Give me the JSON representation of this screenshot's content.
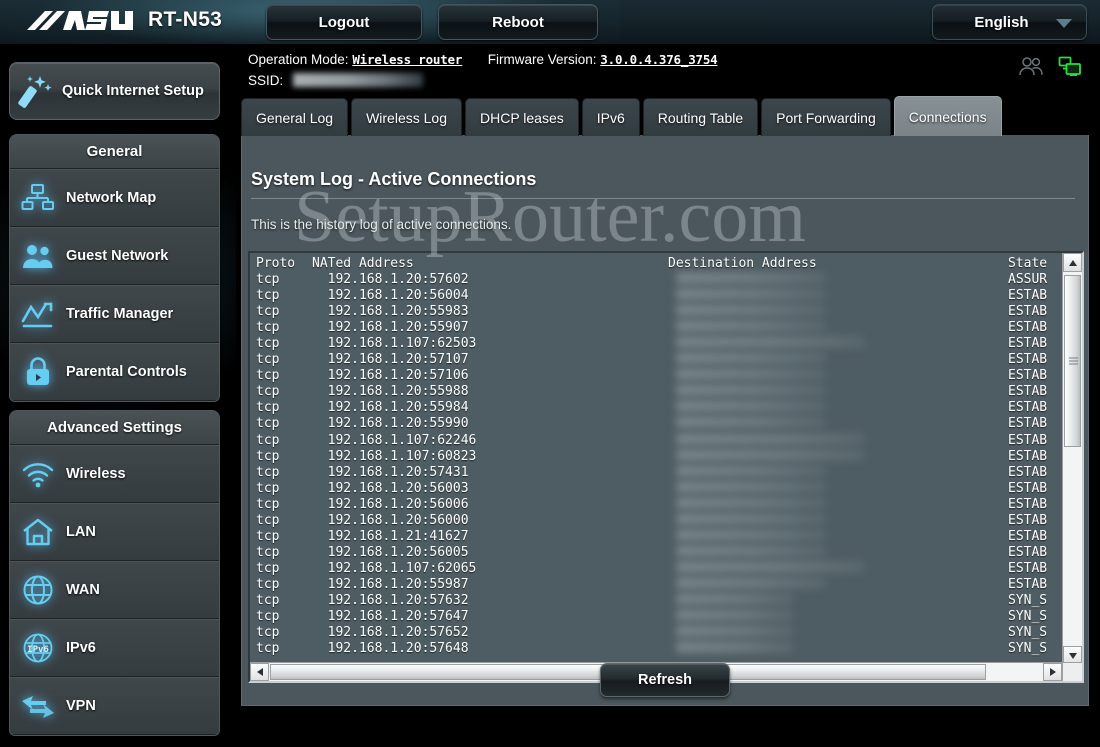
{
  "header": {
    "brand": "ASUS",
    "model": "RT-N53",
    "logout_label": "Logout",
    "reboot_label": "Reboot",
    "language": "English",
    "icons": {
      "clients": "users-icon",
      "network_status": "connected-computers-icon"
    }
  },
  "info": {
    "operation_mode_label": "Operation Mode:",
    "operation_mode_value": "Wireless router",
    "firmware_label": "Firmware Version:",
    "firmware_value": "3.0.0.4.376_3754",
    "ssid_label": "SSID:",
    "ssid_value": ""
  },
  "sidebar": {
    "quick_setup": "Quick Internet Setup",
    "groups": [
      {
        "title": "General",
        "items": [
          {
            "label": "Network Map",
            "icon": "network-map-icon"
          },
          {
            "label": "Guest Network",
            "icon": "guest-network-icon"
          },
          {
            "label": "Traffic Manager",
            "icon": "traffic-manager-icon"
          },
          {
            "label": "Parental Controls",
            "icon": "padlock-icon"
          }
        ]
      },
      {
        "title": "Advanced Settings",
        "items": [
          {
            "label": "Wireless",
            "icon": "wifi-icon"
          },
          {
            "label": "LAN",
            "icon": "home-icon"
          },
          {
            "label": "WAN",
            "icon": "globe-icon"
          },
          {
            "label": "IPv6",
            "icon": "ipv6-globe-icon"
          },
          {
            "label": "VPN",
            "icon": "vpn-arrows-icon"
          }
        ]
      }
    ]
  },
  "tabs": [
    {
      "label": "General Log",
      "active": false
    },
    {
      "label": "Wireless Log",
      "active": false
    },
    {
      "label": "DHCP leases",
      "active": false
    },
    {
      "label": "IPv6",
      "active": false
    },
    {
      "label": "Routing Table",
      "active": false
    },
    {
      "label": "Port Forwarding",
      "active": false
    },
    {
      "label": "Connections",
      "active": true
    }
  ],
  "panel": {
    "title": "System Log - Active Connections",
    "description": "This is the history log of active connections.",
    "refresh_label": "Refresh"
  },
  "log": {
    "columns": [
      "Proto",
      "NATed Address",
      "Destination Address",
      "State"
    ],
    "rows": [
      {
        "proto": "tcp",
        "nated": "192.168.1.20:57602",
        "dest": "",
        "state": "ASSUR"
      },
      {
        "proto": "tcp",
        "nated": "192.168.1.20:56004",
        "dest": "",
        "state": "ESTAB"
      },
      {
        "proto": "tcp",
        "nated": "192.168.1.20:55983",
        "dest": "",
        "state": "ESTAB"
      },
      {
        "proto": "tcp",
        "nated": "192.168.1.20:55907",
        "dest": "",
        "state": "ESTAB"
      },
      {
        "proto": "tcp",
        "nated": "192.168.1.107:62503",
        "dest": "",
        "state": "ESTAB"
      },
      {
        "proto": "tcp",
        "nated": "192.168.1.20:57107",
        "dest": "",
        "state": "ESTAB"
      },
      {
        "proto": "tcp",
        "nated": "192.168.1.20:57106",
        "dest": "",
        "state": "ESTAB"
      },
      {
        "proto": "tcp",
        "nated": "192.168.1.20:55988",
        "dest": "",
        "state": "ESTAB"
      },
      {
        "proto": "tcp",
        "nated": "192.168.1.20:55984",
        "dest": "",
        "state": "ESTAB"
      },
      {
        "proto": "tcp",
        "nated": "192.168.1.20:55990",
        "dest": "",
        "state": "ESTAB"
      },
      {
        "proto": "tcp",
        "nated": "192.168.1.107:62246",
        "dest": "",
        "state": "ESTAB"
      },
      {
        "proto": "tcp",
        "nated": "192.168.1.107:60823",
        "dest": "",
        "state": "ESTAB"
      },
      {
        "proto": "tcp",
        "nated": "192.168.1.20:57431",
        "dest": "",
        "state": "ESTAB"
      },
      {
        "proto": "tcp",
        "nated": "192.168.1.20:56003",
        "dest": "",
        "state": "ESTAB"
      },
      {
        "proto": "tcp",
        "nated": "192.168.1.20:56006",
        "dest": "",
        "state": "ESTAB"
      },
      {
        "proto": "tcp",
        "nated": "192.168.1.20:56000",
        "dest": "",
        "state": "ESTAB"
      },
      {
        "proto": "tcp",
        "nated": "192.168.1.21:41627",
        "dest": "",
        "state": "ESTAB"
      },
      {
        "proto": "tcp",
        "nated": "192.168.1.20:56005",
        "dest": "",
        "state": "ESTAB"
      },
      {
        "proto": "tcp",
        "nated": "192.168.1.107:62065",
        "dest": "",
        "state": "ESTAB"
      },
      {
        "proto": "tcp",
        "nated": "192.168.1.20:55987",
        "dest": "",
        "state": "ESTAB"
      },
      {
        "proto": "tcp",
        "nated": "192.168.1.20:57632",
        "dest": "",
        "state": "SYN_S"
      },
      {
        "proto": "tcp",
        "nated": "192.168.1.20:57647",
        "dest": "",
        "state": "SYN_S"
      },
      {
        "proto": "tcp",
        "nated": "192.168.1.20:57652",
        "dest": "",
        "state": "SYN_S"
      },
      {
        "proto": "tcp",
        "nated": "192.168.1.20:57648",
        "dest": "",
        "state": "SYN_S"
      }
    ]
  },
  "watermark": "SetupRouter.com",
  "colors": {
    "panel_bg": "#4b575c",
    "log_bg": "#4e5d63",
    "accent_cyan": "#6fd4f5",
    "status_green": "#27e03a",
    "active_tab": "#889195"
  }
}
